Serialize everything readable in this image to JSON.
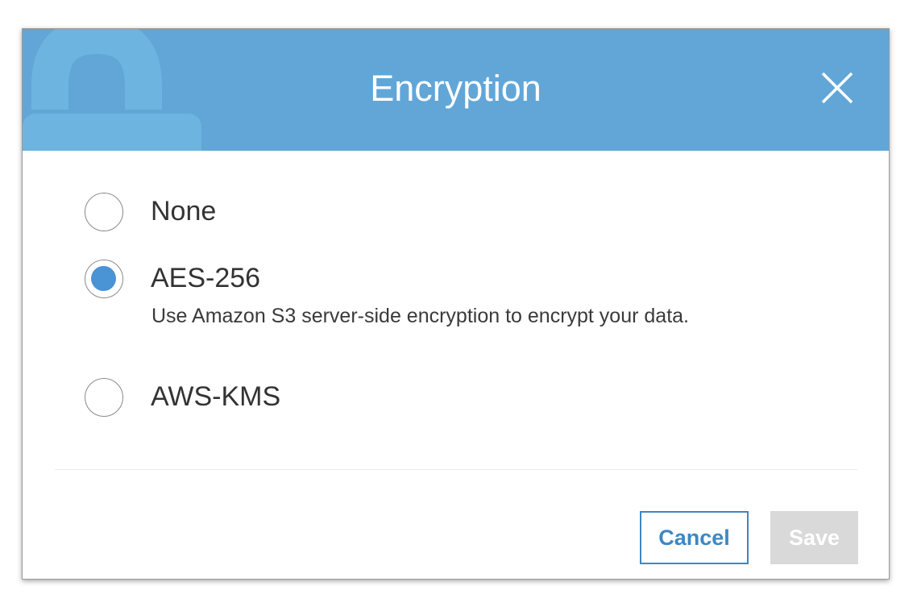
{
  "dialog": {
    "title": "Encryption",
    "header_color": "#62a6d7",
    "icons": {
      "header_decoration": "lock-icon",
      "close": "close-icon"
    }
  },
  "options": [
    {
      "label": "None",
      "checked": false
    },
    {
      "label": "AES-256",
      "checked": true,
      "description": "Use Amazon S3 server-side encryption to encrypt your data."
    },
    {
      "label": "AWS-KMS",
      "checked": false
    }
  ],
  "footer": {
    "cancel_label": "Cancel",
    "save_label": "Save",
    "accent_color": "#3d87c3",
    "save_disabled": true
  }
}
